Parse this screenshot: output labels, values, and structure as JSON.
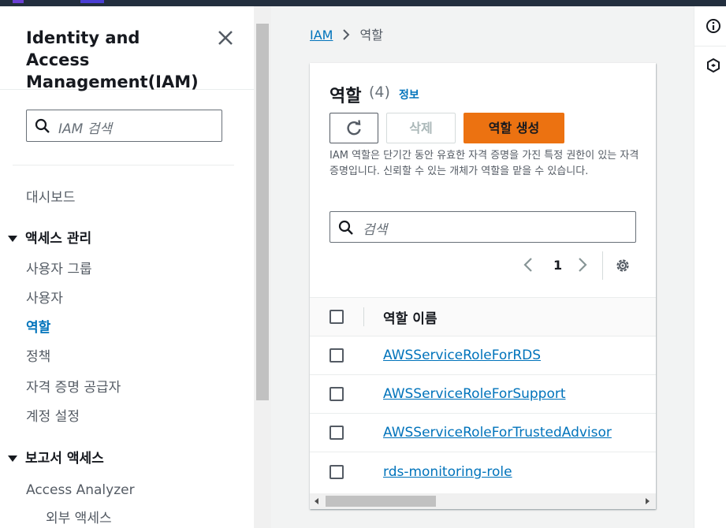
{
  "sidebar": {
    "title": "Identity and Access Management(IAM)",
    "search_placeholder": "IAM 검색",
    "dashboard": "대시보드",
    "section_access": "액세스 관리",
    "access_items": [
      "사용자 그룹",
      "사용자",
      "역할",
      "정책",
      "자격 증명 공급자",
      "계정 설정"
    ],
    "active_item": "역할",
    "section_reports": "보고서 액세스",
    "report_items": [
      "Access Analyzer",
      "외부 액세스"
    ]
  },
  "breadcrumb": {
    "root": "IAM",
    "current": "역할"
  },
  "panel": {
    "title": "역할",
    "count": "(4)",
    "info_link": "정보",
    "delete_label": "삭제",
    "create_label": "역할 생성",
    "description": "IAM 역할은 단기간 동안 유효한 자격 증명을 가진 특정 권한이 있는 자격 증명입니다. 신뢰할 수 있는 개체가 역할을 맡을 수 있습니다.",
    "search_placeholder": "검색",
    "page": "1",
    "column_header": "역할 이름",
    "rows": [
      "AWSServiceRoleForRDS",
      "AWSServiceRoleForSupport",
      "AWSServiceRoleForTrustedAdvisor",
      "rds-monitoring-role"
    ]
  },
  "colors": {
    "primary_button": "#ec7211",
    "link": "#0073bb",
    "topbar": "#232f3e"
  }
}
